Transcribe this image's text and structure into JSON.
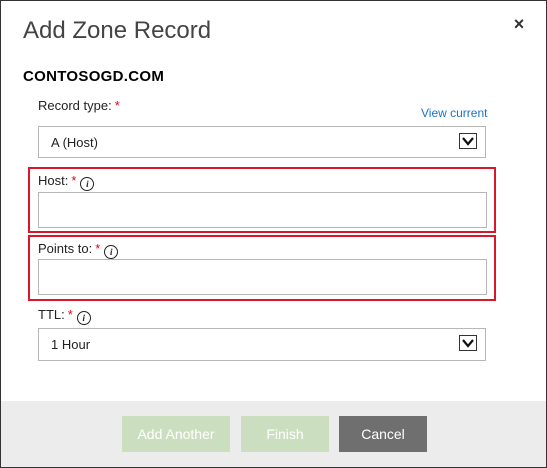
{
  "dialog": {
    "title": "Add Zone Record",
    "close_glyph": "×",
    "domain": "CONTOSOGD.COM"
  },
  "form": {
    "record_type": {
      "label": "Record type:",
      "required_mark": "*",
      "value": "A (Host)",
      "link": "View current"
    },
    "host": {
      "label": "Host:",
      "required_mark": "*",
      "info_glyph": "i",
      "value": ""
    },
    "points_to": {
      "label": "Points to:",
      "required_mark": "*",
      "info_glyph": "i",
      "value": ""
    },
    "ttl": {
      "label": "TTL:",
      "required_mark": "*",
      "info_glyph": "i",
      "value": "1 Hour"
    }
  },
  "footer": {
    "add_another": "Add Another",
    "finish": "Finish",
    "cancel": "Cancel"
  },
  "colors": {
    "required": "#e0001b",
    "highlight_border": "#d6182a",
    "link": "#1a73c8",
    "disabled_button": "#cbdfc0",
    "cancel_button": "#6f6f6f",
    "footer_bg": "#ececec"
  },
  "icons": {
    "close": "close-icon",
    "info": "info-icon",
    "dropdown": "chevron-down-icon"
  }
}
